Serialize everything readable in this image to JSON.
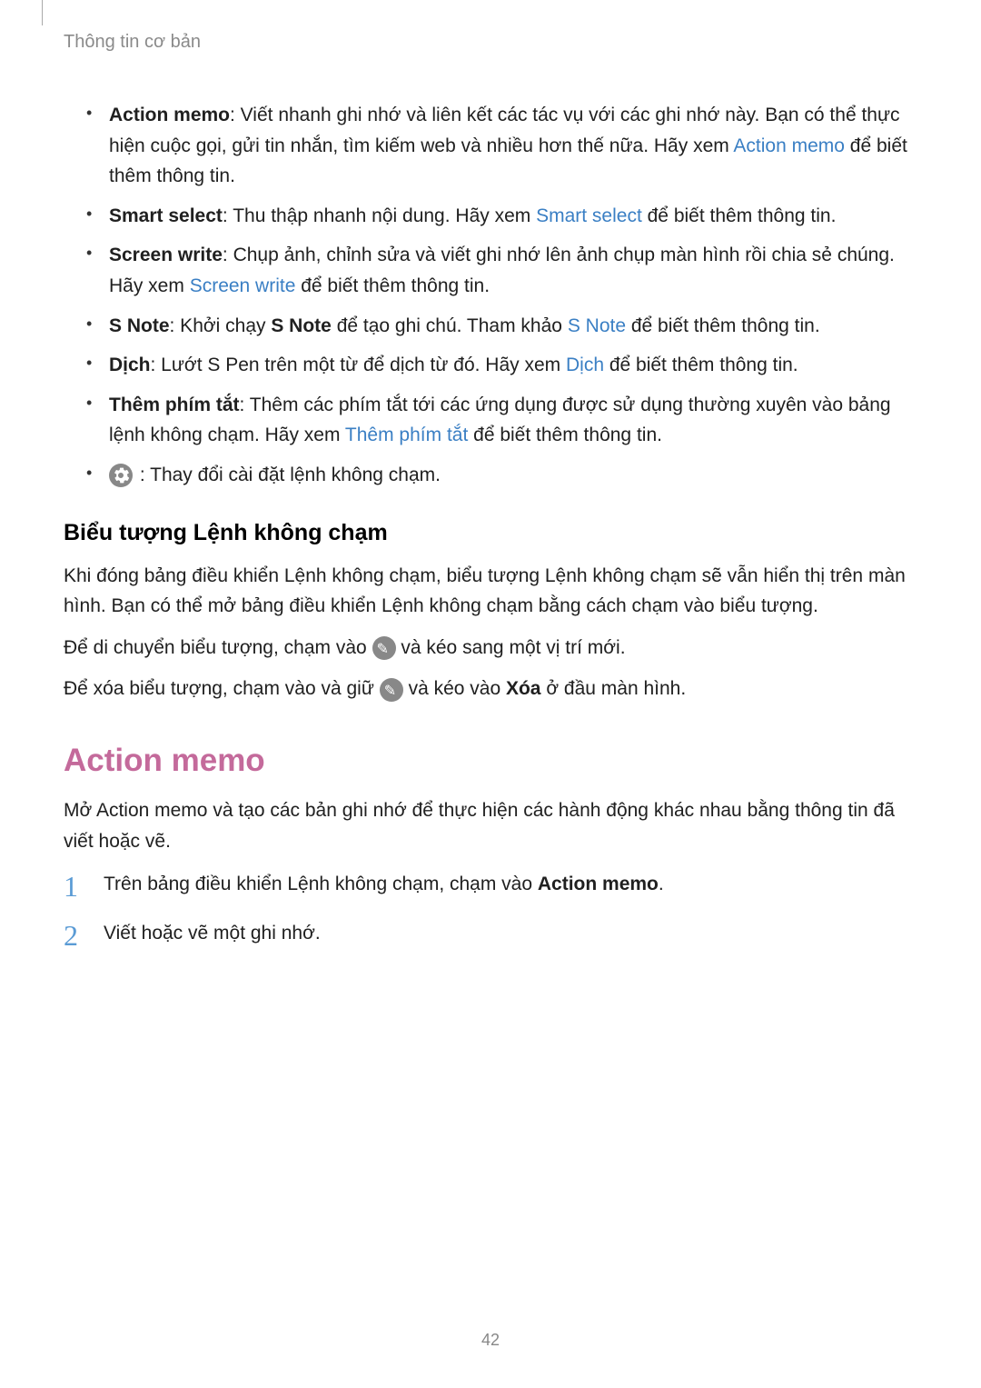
{
  "header": "Thông tin cơ bản",
  "features": {
    "action_memo": {
      "label": "Action memo",
      "desc_a": ": Viết nhanh ghi nhớ và liên kết các tác vụ với các ghi nhớ này. Bạn có thể thực hiện cuộc gọi, gửi tin nhắn, tìm kiếm web và nhiều hơn thế nữa. Hãy xem ",
      "link": "Action memo",
      "desc_b": " để biết thêm thông tin."
    },
    "smart_select": {
      "label": "Smart select",
      "desc_a": ": Thu thập nhanh nội dung. Hãy xem ",
      "link": "Smart select",
      "desc_b": " để biết thêm thông tin."
    },
    "screen_write": {
      "label": "Screen write",
      "desc_a": ": Chụp ảnh, chỉnh sửa và viết ghi nhớ lên ảnh chụp màn hình rồi chia sẻ chúng. Hãy xem ",
      "link": "Screen write",
      "desc_b": " để biết thêm thông tin."
    },
    "s_note": {
      "label": "S Note",
      "desc_a": ": Khởi chạy ",
      "bold_inline": "S Note",
      "desc_b": " để tạo ghi chú. Tham khảo ",
      "link": "S Note",
      "desc_c": " để biết thêm thông tin."
    },
    "dich": {
      "label": "Dịch",
      "desc_a": ": Lướt S Pen trên một từ để dịch từ đó. Hãy xem ",
      "link": "Dịch",
      "desc_b": " để biết thêm thông tin."
    },
    "them_phim_tat": {
      "label": "Thêm phím tắt",
      "desc_a": ": Thêm các phím tắt tới các ứng dụng được sử dụng thường xuyên vào bảng lệnh không chạm. Hãy xem ",
      "link": "Thêm phím tắt",
      "desc_b": " để biết thêm thông tin."
    },
    "settings": {
      "desc": " : Thay đổi cài đặt lệnh không chạm."
    }
  },
  "subhead": "Biểu tượng Lệnh không chạm",
  "para1": "Khi đóng bảng điều khiển Lệnh không chạm, biểu tượng Lệnh không chạm sẽ vẫn hiển thị trên màn hình. Bạn có thể mở bảng điều khiển Lệnh không chạm bằng cách chạm vào biểu tượng.",
  "para2_a": "Để di chuyển biểu tượng, chạm vào ",
  "para2_b": " và kéo sang một vị trí mới.",
  "para3_a": "Để xóa biểu tượng, chạm vào và giữ ",
  "para3_b": " và kéo vào ",
  "para3_bold": "Xóa",
  "para3_c": " ở đầu màn hình.",
  "section_title": "Action memo",
  "section_intro": "Mở Action memo và tạo các bản ghi nhớ để thực hiện các hành động khác nhau bằng thông tin đã viết hoặc vẽ.",
  "step1_a": "Trên bảng điều khiển Lệnh không chạm, chạm vào ",
  "step1_bold": "Action memo",
  "step1_b": ".",
  "step2": "Viết hoặc vẽ một ghi nhớ.",
  "page_number": "42"
}
